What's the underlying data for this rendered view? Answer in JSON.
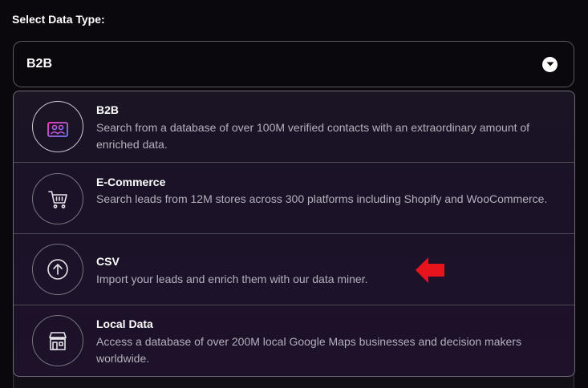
{
  "form": {
    "label": "Select Data Type:"
  },
  "select": {
    "value": "B2B",
    "icon": "chevron-down-icon"
  },
  "options": [
    {
      "title": "B2B",
      "description": "Search from a database of over 100M verified contacts with an extraordinary amount of enriched data.",
      "icon": "contacts-icon"
    },
    {
      "title": "E-Commerce",
      "description": "Search leads from 12M stores across 300 platforms including Shopify and WooCommerce.",
      "icon": "shopping-cart-icon"
    },
    {
      "title": "CSV",
      "description": "Import your leads and enrich them with our data miner.",
      "icon": "upload-icon"
    },
    {
      "title": "Local Data",
      "description": "Access a database of over 200M local Google Maps businesses and decision makers worldwide.",
      "icon": "storefront-icon"
    }
  ],
  "colors": {
    "accent_gradient_start": "#ff3ec8",
    "accent_gradient_end": "#6b7dff",
    "pointer": "#e8141c"
  }
}
